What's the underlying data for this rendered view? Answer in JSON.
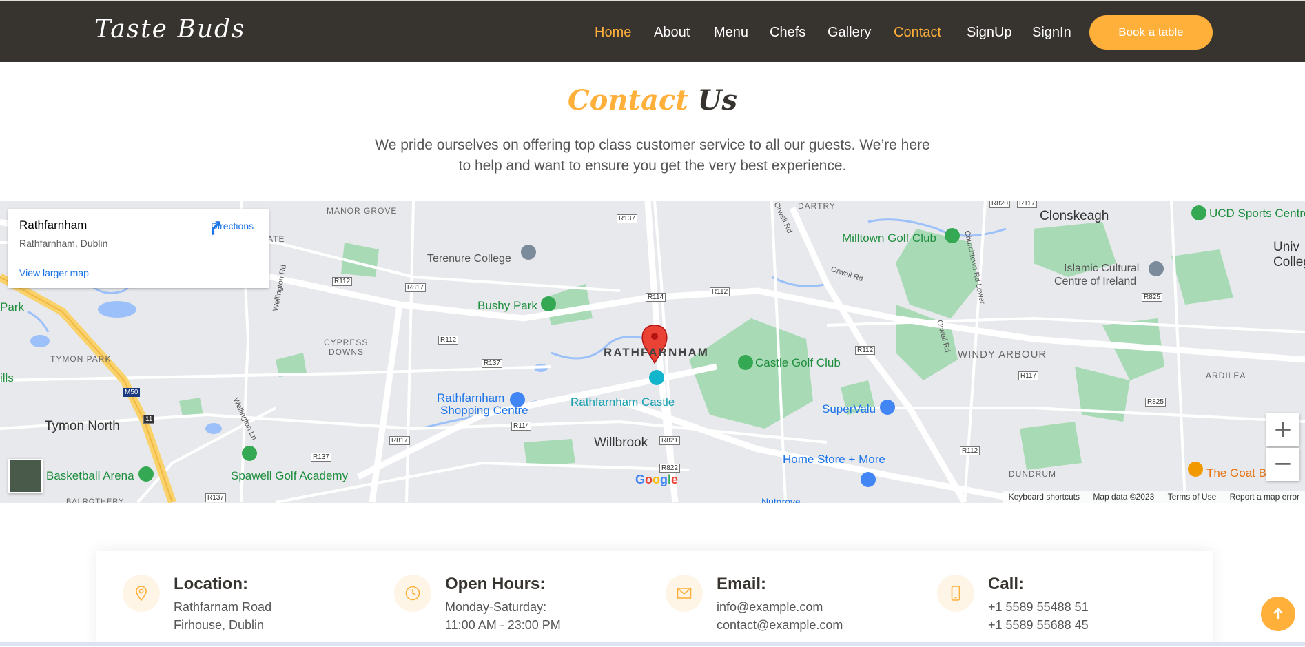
{
  "header": {
    "logo": "Taste Buds",
    "nav": [
      {
        "label": "Home",
        "active": true
      },
      {
        "label": "About",
        "active": false
      },
      {
        "label": "Menu",
        "active": false
      },
      {
        "label": "Chefs",
        "active": false
      },
      {
        "label": "Gallery",
        "active": false
      },
      {
        "label": "Contact",
        "active": true
      },
      {
        "label": "SignUp",
        "active": false
      },
      {
        "label": "SignIn",
        "active": false
      }
    ],
    "book_label": "Book a table"
  },
  "section": {
    "title_part1": "Contact",
    "title_part2": "Us",
    "intro": "We pride ourselves on offering top class customer service to all our guests. We’re here to help and want to ensure you get the very best experience."
  },
  "map": {
    "place_name": "Rathfarnham",
    "place_address": "Rathfarnham, Dublin",
    "directions_label": "Directions",
    "view_larger": "View larger map",
    "labels": {
      "manor_grove": "MANOR GROVE",
      "dartry": "DARTRY",
      "clonskeagh": "Clonskeagh",
      "ucd": "UCD Sports Centre",
      "univ": "Univ",
      "college": "College",
      "terenure": "Terenure College",
      "milltown": "Milltown Golf Club",
      "islamic1": "Islamic Cultural",
      "islamic2": "Centre of Ireland",
      "bushy": "Bushy Park",
      "park": "Park",
      "cypress1": "CYPRESS",
      "cypress2": "DOWNS",
      "rathfarnham": "RATHFARNHAM",
      "castle_golf": "Castle Golf Club",
      "windy": "WINDY ARBOUR",
      "ardilea": "ARDILEA",
      "tymon_park": "TYMON PARK",
      "ills": "ills",
      "shopping1": "Rathfarnham",
      "shopping2": "Shopping Centre",
      "castle": "Rathfarnham Castle",
      "supervalu": "SuperValu",
      "tymon_north": "Tymon North",
      "willbrook": "Willbrook",
      "home_store": "Home Store + More",
      "basketball": "Basketball Arena",
      "spawell": "Spawell Golf Academy",
      "dundrum": "DUNDRUM",
      "goat": "The Goat B",
      "balrothery": "BALROTHERY",
      "nutgrove": "Nutgrove",
      "wellington": "Wellington Rd",
      "wellington_ln": "Wellington Ln",
      "orwell": "Orwell Rd",
      "orwell2": "Orwell Rd",
      "churchtown": "Churchtown Rd Lower",
      "orwell3": "Orwell Rd",
      "ate": "ATE"
    },
    "roads": {
      "r137a": "R137",
      "r820": "R820",
      "r117a": "R117",
      "r112a": "R112",
      "r817a": "R817",
      "r114a": "R114",
      "r112b": "R112",
      "r825a": "R825",
      "r112c": "R112",
      "r137b": "R137",
      "r112d": "R112",
      "r117b": "R117",
      "m50": "M50",
      "exit11": "11",
      "r114b": "R114",
      "r825b": "R825",
      "r817b": "R817",
      "r821": "R821",
      "r137c": "R137",
      "r822": "R822",
      "r112e": "R112",
      "r137d": "R137"
    },
    "google": "Google",
    "footer": [
      "Keyboard shortcuts",
      "Map data ©2023",
      "Terms of Use",
      "Report a map error"
    ],
    "zoom_in": "+",
    "zoom_out": "−"
  },
  "info": [
    {
      "icon": "location-icon",
      "title": "Location:",
      "line1": "Rathfarnam Road",
      "line2": "Firhouse, Dublin"
    },
    {
      "icon": "clock-icon",
      "title": "Open Hours:",
      "line1": "Monday-Saturday:",
      "line2": "11:00 AM - 23:00 PM"
    },
    {
      "icon": "envelope-icon",
      "title": "Email:",
      "line1": "info@example.com",
      "line2": "contact@example.com"
    },
    {
      "icon": "phone-icon",
      "title": "Call:",
      "line1": "+1 5589 55488 51",
      "line2": "+1 5589 55688 45"
    }
  ],
  "colors": {
    "accent": "#ffb03b",
    "header_bg": "#37332f",
    "map_bg": "#e8e9ec",
    "park": "#a8dab5",
    "link": "#1a73e8"
  }
}
